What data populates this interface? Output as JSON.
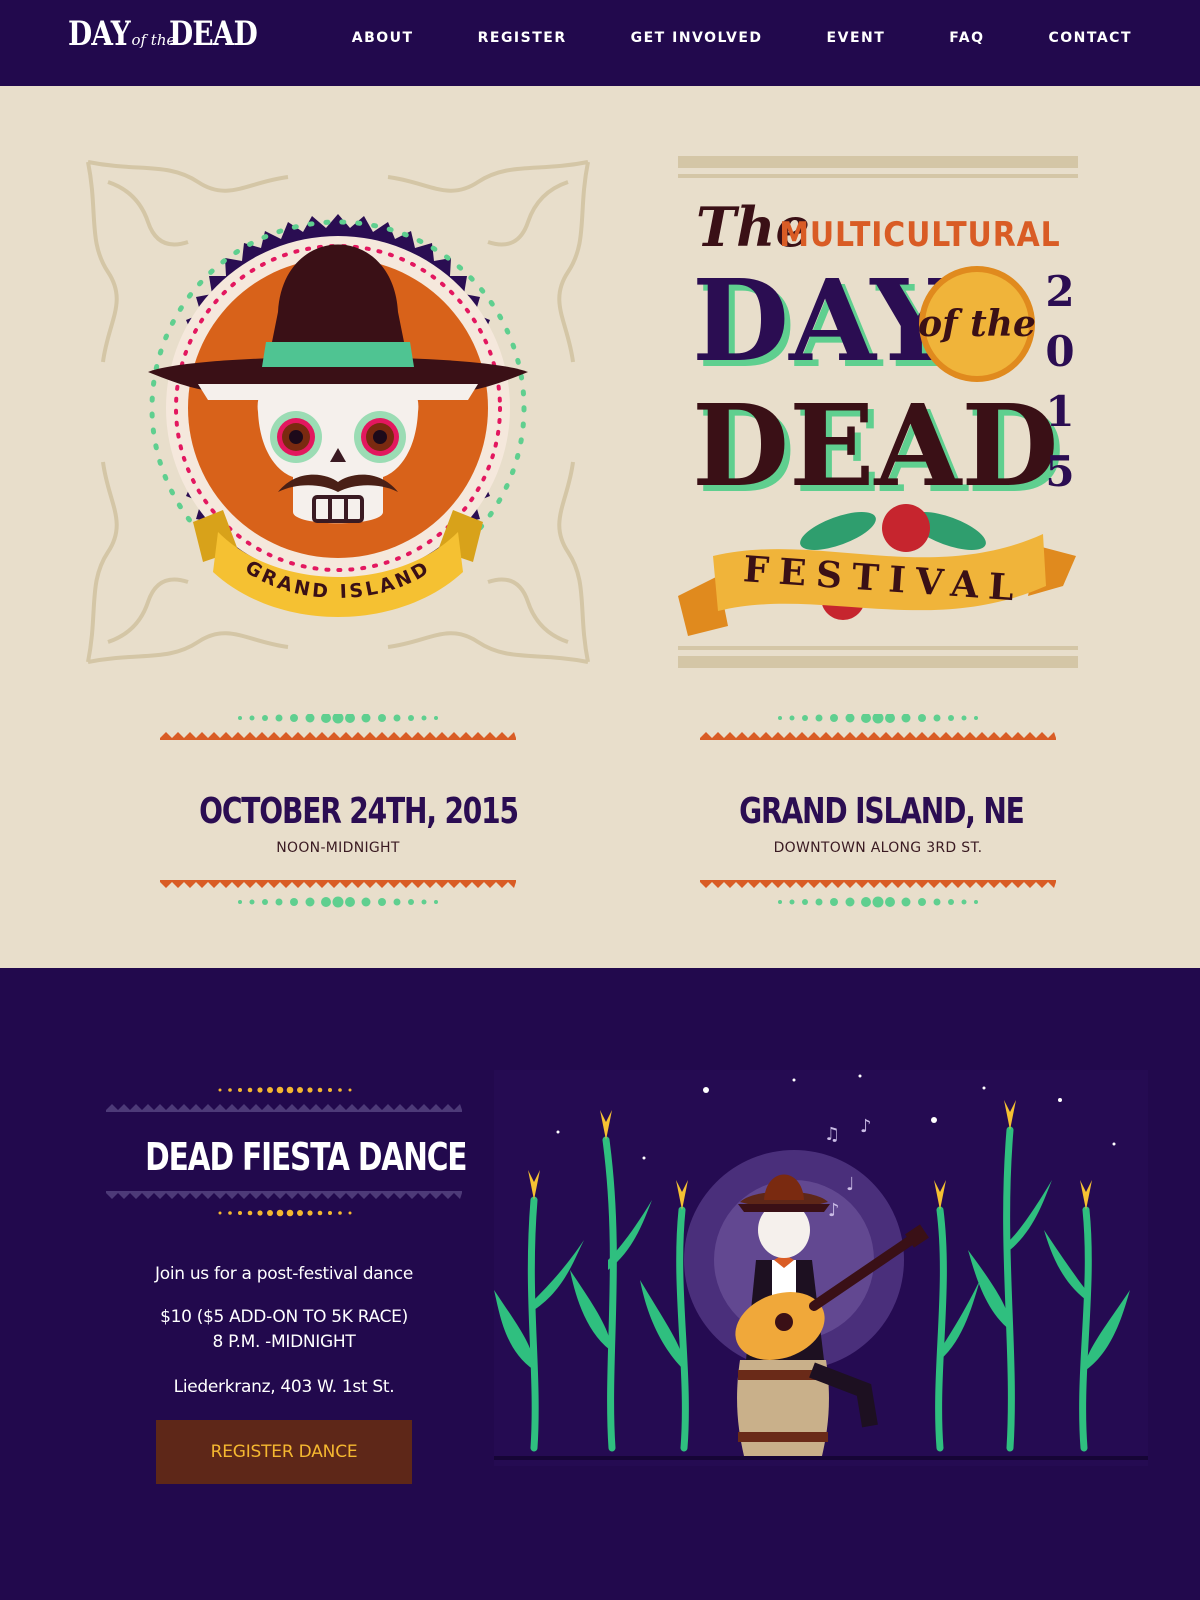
{
  "nav": {
    "logo": {
      "word1": "DAY",
      "of_the": "of the",
      "word2": "DEAD"
    },
    "items": [
      "ABOUT",
      "REGISTER",
      "GET INVOLVED",
      "EVENT",
      "FAQ",
      "CONTACT"
    ]
  },
  "hero": {
    "badge_text": "GRAND ISLAND",
    "poster": {
      "the": "The",
      "multicultural": "MULTICULTURAL",
      "day": "DAY",
      "of_the": "of the",
      "dead": "DEAD",
      "festival": "FESTIVAL",
      "year_digits": [
        "2",
        "0",
        "1",
        "5"
      ]
    },
    "date": {
      "title": "OCTOBER 24TH, 2015",
      "subtitle": "NOON-MIDNIGHT"
    },
    "location": {
      "title": "GRAND ISLAND, NE",
      "subtitle": "DOWNTOWN ALONG 3RD ST."
    }
  },
  "dance": {
    "title": "DEAD FIESTA DANCE",
    "intro": "Join us for a post-festival dance",
    "price": "$10 ($5 ADD-ON TO 5K RACE)",
    "time": "8 P.M. -MIDNIGHT",
    "venue": "Liederkranz, 403 W. 1st St.",
    "button": "REGISTER DANCE"
  },
  "colors": {
    "nav_bg": "#22094d",
    "hero_bg": "#e8decb",
    "accent_orange": "#d95c25",
    "accent_green": "#5fcf8f",
    "button_bg": "#5e2718",
    "button_text": "#f5b830"
  }
}
